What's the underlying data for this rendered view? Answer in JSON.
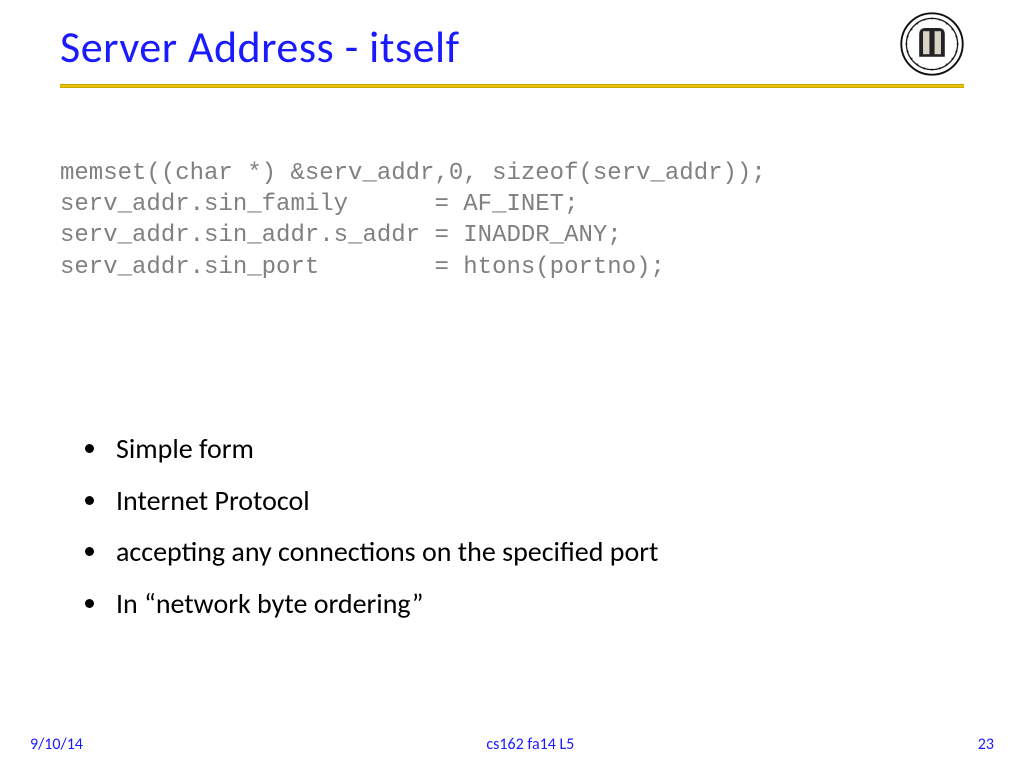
{
  "title": "Server Address - itself",
  "code": {
    "line1": "memset((char *) &serv_addr,0, sizeof(serv_addr));",
    "line2": "serv_addr.sin_family      = AF_INET;",
    "line3": "serv_addr.sin_addr.s_addr = INADDR_ANY;",
    "line4": "serv_addr.sin_port        = htons(portno);"
  },
  "bullets": {
    "b1": "Simple form",
    "b2": "Internet Protocol",
    "b3": "accepting any connections on the specified port",
    "b4": "In “network byte ordering”"
  },
  "footer": {
    "date": "9/10/14",
    "course": "cs162 fa14 L5",
    "page": "23"
  }
}
